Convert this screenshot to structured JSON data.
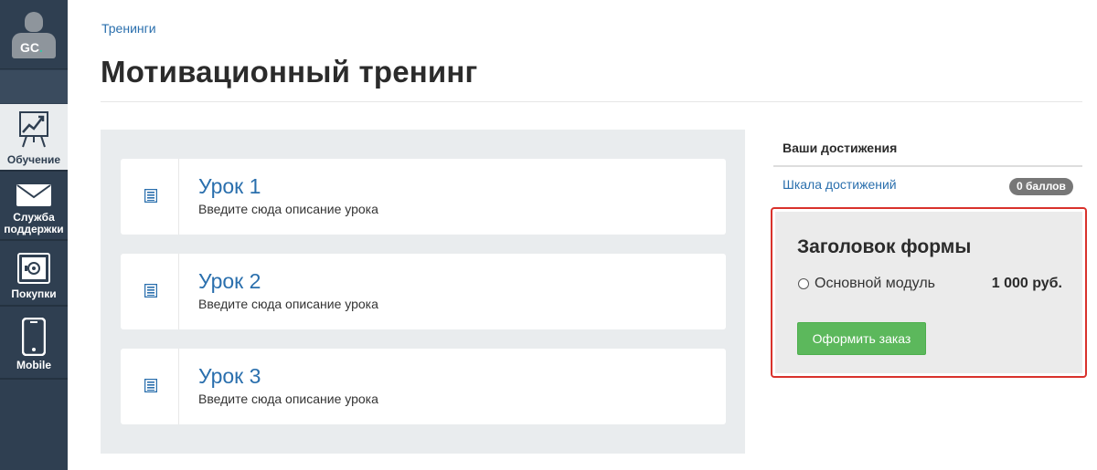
{
  "sidebar": {
    "logo": {
      "text": "GC",
      "dot": "."
    },
    "items": [
      {
        "label": "Обучение",
        "icon": "chart-board-icon",
        "active": true
      },
      {
        "label": "Служба поддержки",
        "icon": "envelope-icon",
        "active": false
      },
      {
        "label": "Покупки",
        "icon": "safe-icon",
        "active": false
      },
      {
        "label": "Mobile",
        "icon": "smartphone-icon",
        "active": false
      }
    ]
  },
  "header": {
    "breadcrumb": "Тренинги",
    "title": "Мотивационный тренинг"
  },
  "lessons": [
    {
      "title": "Урок 1",
      "description": "Введите сюда описание урока",
      "icon": "document-list-icon"
    },
    {
      "title": "Урок 2",
      "description": "Введите сюда описание урока",
      "icon": "document-list-icon"
    },
    {
      "title": "Урок 3",
      "description": "Введите сюда описание урока",
      "icon": "document-list-icon"
    }
  ],
  "achievements": {
    "title": "Ваши достижения",
    "link": "Шкала достижений",
    "badge": "0 баллов"
  },
  "order_form": {
    "title": "Заголовок формы",
    "option_label": "Основной модуль",
    "option_price": "1 000 руб.",
    "option_selected": false,
    "button_label": "Оформить заказ"
  },
  "colors": {
    "sidebar_bg": "#2f3f51",
    "link": "#2a6fad",
    "button_green": "#5cb85c",
    "highlight_border": "#d9322c",
    "badge_bg": "#777777"
  }
}
